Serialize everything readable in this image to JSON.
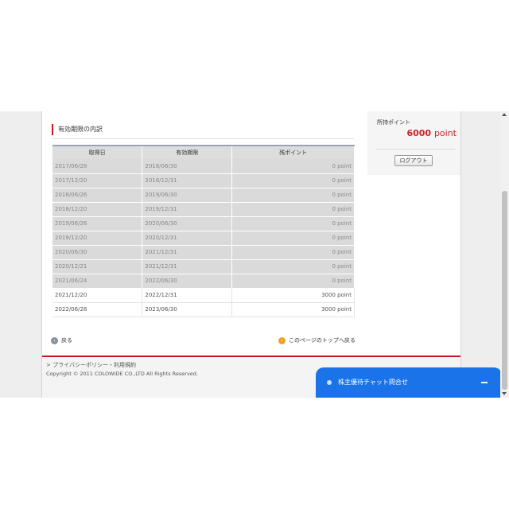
{
  "section": {
    "title": "有効期限の内訳"
  },
  "table": {
    "headers": [
      "取得日",
      "有効期限",
      "残ポイント"
    ],
    "rows": [
      {
        "acquired": "2017/06/28",
        "expires": "2018/06/30",
        "points": "0 point",
        "expired": true
      },
      {
        "acquired": "2017/12/20",
        "expires": "2018/12/31",
        "points": "0 point",
        "expired": true
      },
      {
        "acquired": "2018/06/26",
        "expires": "2019/06/30",
        "points": "0 point",
        "expired": true
      },
      {
        "acquired": "2018/12/20",
        "expires": "2019/12/31",
        "points": "0 point",
        "expired": true
      },
      {
        "acquired": "2019/06/26",
        "expires": "2020/06/30",
        "points": "0 point",
        "expired": true
      },
      {
        "acquired": "2019/12/20",
        "expires": "2020/12/31",
        "points": "0 point",
        "expired": true
      },
      {
        "acquired": "2020/06/30",
        "expires": "2021/12/31",
        "points": "0 point",
        "expired": true
      },
      {
        "acquired": "2020/12/21",
        "expires": "2021/12/31",
        "points": "0 point",
        "expired": true
      },
      {
        "acquired": "2021/06/24",
        "expires": "2022/06/30",
        "points": "0 point",
        "expired": true
      },
      {
        "acquired": "2021/12/20",
        "expires": "2022/12/31",
        "points": "3000 point",
        "expired": false
      },
      {
        "acquired": "2022/06/28",
        "expires": "2023/06/30",
        "points": "3000 point",
        "expired": false
      }
    ]
  },
  "links": {
    "back": "戻る",
    "page_top": "このページのトップへ戻る"
  },
  "footer": {
    "links": "> プライバシーポリシー・利用規約",
    "copyright": "Copyright © 2011 COLOWIDE CO.,LTD All Rights Reserved."
  },
  "points_panel": {
    "label": "所持ポイント",
    "value": "6000",
    "unit": "point",
    "logout": "ログアウト"
  },
  "chat": {
    "label": "株主優待チャット問合せ",
    "color": "#1a73e8"
  },
  "colors": {
    "accent": "#c8161e",
    "points": "#d0202a"
  }
}
